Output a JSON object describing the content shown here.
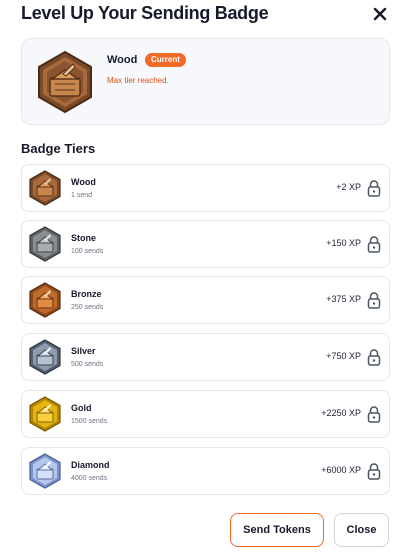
{
  "modal": {
    "title": "Level Up Your Sending Badge",
    "close_icon": "close-icon"
  },
  "current": {
    "name": "Wood",
    "badge_label": "Current",
    "subtitle": "Max tier reached.",
    "icon": "wood-badge-icon"
  },
  "tiers_title": "Badge Tiers",
  "tiers": [
    {
      "name": "Wood",
      "sends": "1 send",
      "xp": "+2 XP",
      "icon": "wood-badge-icon"
    },
    {
      "name": "Stone",
      "sends": "100 sends",
      "xp": "+150 XP",
      "icon": "stone-badge-icon"
    },
    {
      "name": "Bronze",
      "sends": "250 sends",
      "xp": "+375 XP",
      "icon": "bronze-badge-icon"
    },
    {
      "name": "Silver",
      "sends": "500 sends",
      "xp": "+750 XP",
      "icon": "silver-badge-icon"
    },
    {
      "name": "Gold",
      "sends": "1500 sends",
      "xp": "+2250 XP",
      "icon": "gold-badge-icon"
    },
    {
      "name": "Diamond",
      "sends": "4000 sends",
      "xp": "+6000 XP",
      "icon": "diamond-badge-icon"
    }
  ],
  "footer": {
    "send_label": "Send Tokens",
    "close_label": "Close"
  },
  "colors": {
    "accent": "#f26b2a",
    "current_subtitle": "#d4531b"
  }
}
